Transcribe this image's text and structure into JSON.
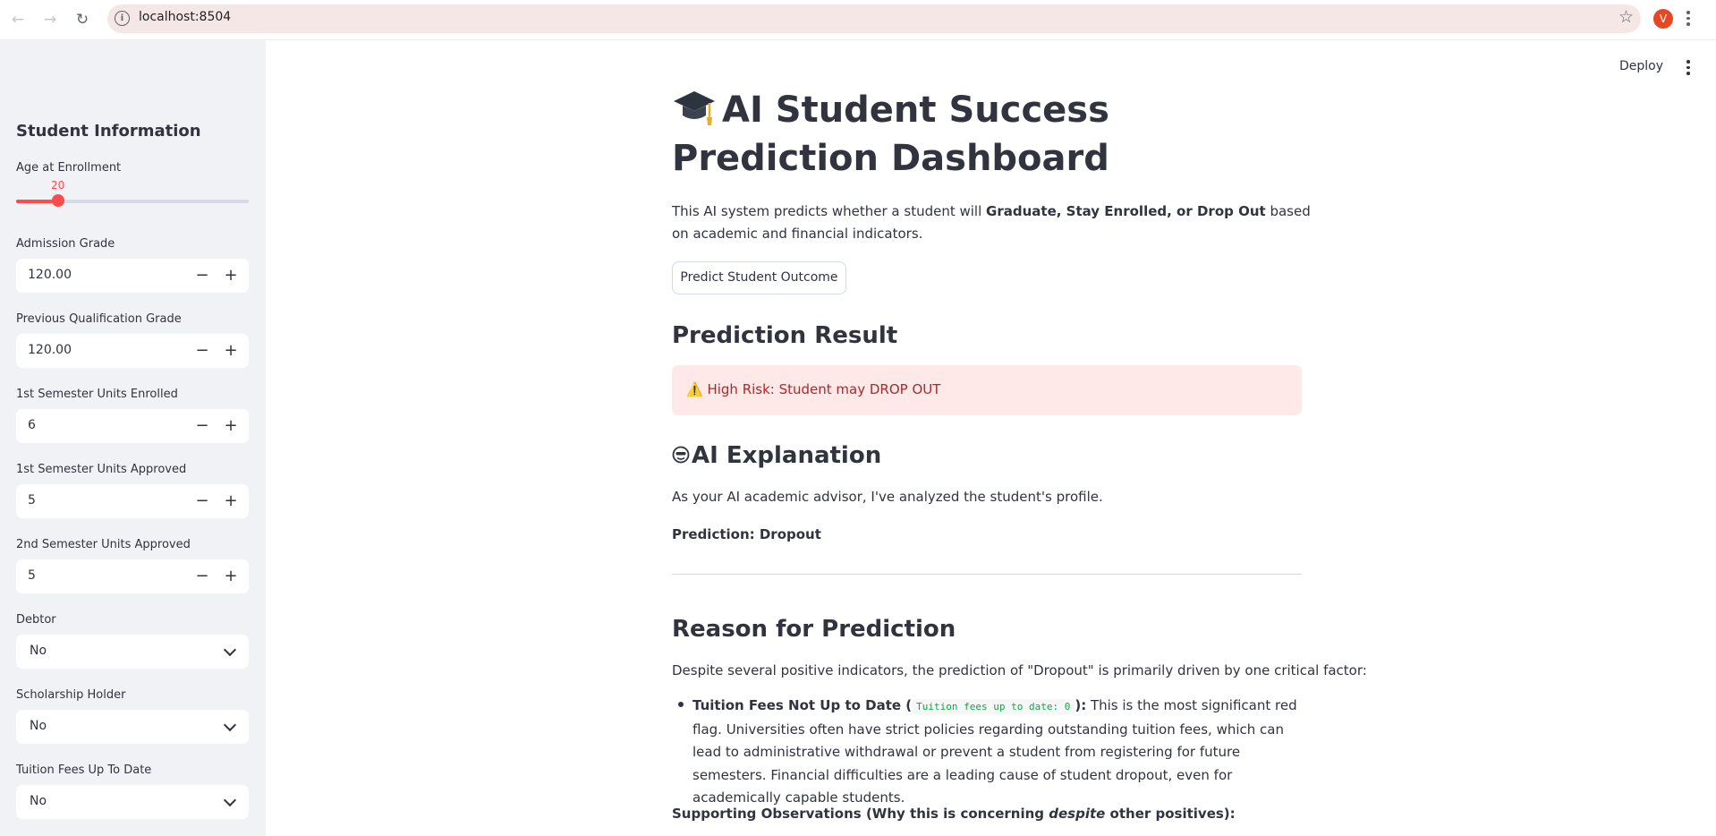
{
  "browser": {
    "url": "localhost:8504",
    "profile_initial": "V"
  },
  "header": {
    "deploy_label": "Deploy"
  },
  "sidebar": {
    "title": "Student Information",
    "age": {
      "label": "Age at Enrollment",
      "value": "20",
      "fraction": 0.18
    },
    "admission_grade": {
      "label": "Admission Grade",
      "value": "120.00"
    },
    "previous_grade": {
      "label": "Previous Qualification Grade",
      "value": "120.00"
    },
    "sem1_enrolled": {
      "label": "1st Semester Units Enrolled",
      "value": "6"
    },
    "sem1_approved": {
      "label": "1st Semester Units Approved",
      "value": "5"
    },
    "sem2_approved": {
      "label": "2nd Semester Units Approved",
      "value": "5"
    },
    "debtor": {
      "label": "Debtor",
      "value": "No"
    },
    "scholarship": {
      "label": "Scholarship Holder",
      "value": "No"
    },
    "tuition": {
      "label": "Tuition Fees Up To Date",
      "value": "No"
    },
    "minus": "−",
    "plus": "+"
  },
  "main": {
    "title": "AI Student Success Prediction Dashboard",
    "intro_pre": "This AI system predicts whether a student will ",
    "intro_bold": "Graduate, Stay Enrolled, or Drop Out",
    "intro_post": " based on academic and financial indicators.",
    "predict_button": "Predict Student Outcome",
    "result_heading": "Prediction Result",
    "alert_text": "⚠️ High Risk: Student may DROP OUT",
    "explanation_heading": "AI Explanation",
    "advisor_text": "As your AI academic advisor, I've analyzed the student's profile.",
    "prediction_line": "Prediction: Dropout",
    "reason_heading": "Reason for Prediction",
    "reason_text": "Despite several positive indicators, the prediction of \"Dropout\" is primarily driven by one critical factor:",
    "bullet_bold": "Tuition Fees Not Up to Date",
    "bullet_open": " (",
    "bullet_code": "Tuition fees up to date: 0",
    "bullet_close": "):",
    "bullet_text": " This is the most significant red flag. Universities often have strict policies regarding outstanding tuition fees, which can lead to administrative withdrawal or prevent a student from registering for future semesters. Financial difficulties are a leading cause of student dropout, even for academically capable students.",
    "support_pre": "Supporting Observations (Why this is concerning ",
    "support_em": "despite",
    "support_post": " other positives):"
  },
  "colors": {
    "accent": "#ff4b4b",
    "sidebar_bg": "#f0f2f6",
    "alert_bg": "#ffe8e8",
    "alert_text": "#a62b2b"
  },
  "icons": [
    "back-arrow-icon",
    "forward-arrow-icon",
    "reload-icon",
    "site-info-icon",
    "star-icon",
    "more-vert-icon",
    "graduation-cap-icon",
    "face-icon",
    "chevron-down-icon"
  ]
}
